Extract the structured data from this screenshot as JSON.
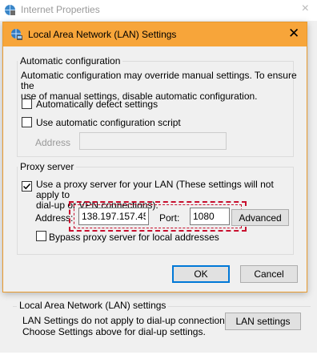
{
  "parent": {
    "title": "Internet Properties",
    "close_glyph": "×",
    "lan_group_label": "Local Area Network (LAN) settings",
    "lan_group_text_line1": "LAN Settings do not apply to dial-up connections.",
    "lan_group_text_line2": "Choose Settings above for dial-up settings.",
    "lan_settings_button": "LAN settings"
  },
  "dialog": {
    "title": "Local Area Network (LAN) Settings",
    "close_glyph": "✕",
    "title_bar_color": "#f7a53a"
  },
  "auto_config": {
    "label": "Automatic configuration",
    "description_line1": "Automatic configuration may override manual settings.  To ensure the",
    "description_line2": "use of manual settings, disable automatic configuration.",
    "auto_detect_label": "Automatically detect settings",
    "auto_detect_checked": false,
    "script_label": "Use automatic configuration script",
    "script_checked": false,
    "address_label": "Address",
    "address_value": ""
  },
  "proxy": {
    "label": "Proxy server",
    "use_proxy_label_line1": "Use a proxy server for your LAN (These settings will not apply to",
    "use_proxy_label_line2": "dial-up or VPN connections).",
    "use_proxy_checked": true,
    "address_label": "Address:",
    "address_value": "138.197.157.45",
    "port_label": "Port:",
    "port_value": "1080",
    "advanced_button": "Advanced",
    "bypass_label": "Bypass proxy server for local addresses",
    "bypass_checked": false,
    "highlight_color": "#c8102e"
  },
  "buttons": {
    "ok": "OK",
    "cancel": "Cancel"
  },
  "icons": {
    "parent_icon": "globe-settings-icon",
    "dialog_icon": "globe-network-icon",
    "checkmark": "checkmark-icon"
  }
}
